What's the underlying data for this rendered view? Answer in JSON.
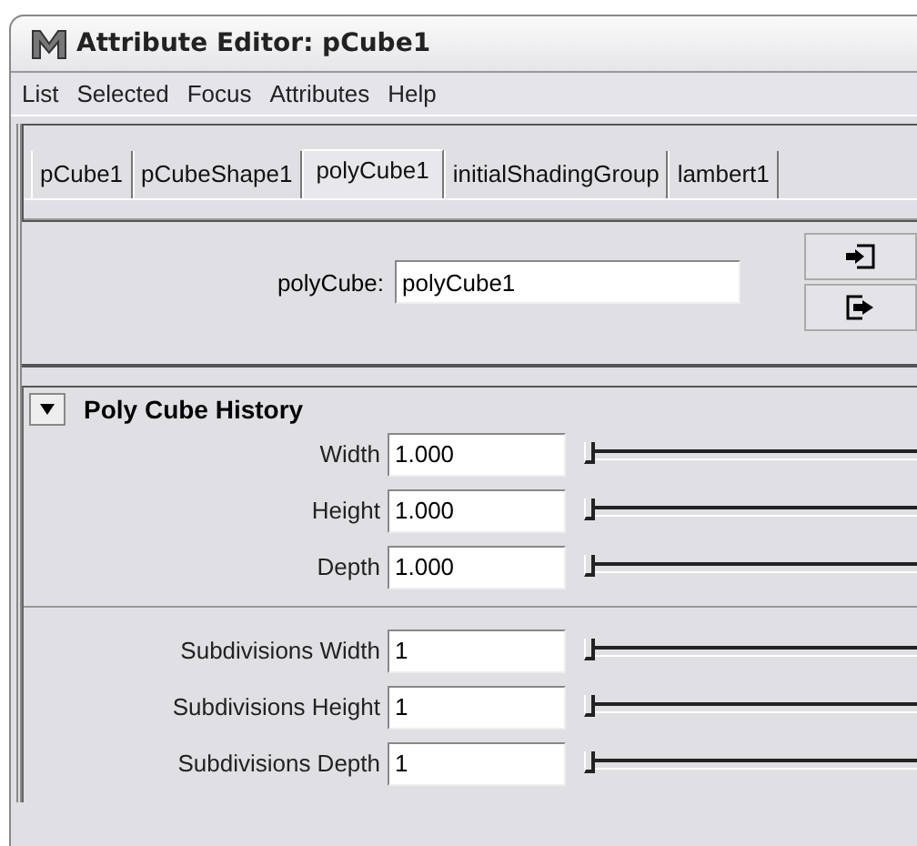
{
  "window": {
    "title": "Attribute Editor: pCube1"
  },
  "menu": [
    "List",
    "Selected",
    "Focus",
    "Attributes",
    "Help"
  ],
  "tabs": [
    {
      "label": "pCube1",
      "selected": false
    },
    {
      "label": "pCubeShape1",
      "selected": false
    },
    {
      "label": "polyCube1",
      "selected": true
    },
    {
      "label": "initialShadingGroup",
      "selected": false
    },
    {
      "label": "lambert1",
      "selected": false
    }
  ],
  "node": {
    "label": "polyCube:",
    "value": "polyCube1"
  },
  "section": {
    "title": "Poly Cube History",
    "expanded": true,
    "groups": [
      [
        {
          "label": "Width",
          "value": "1.000",
          "level": 0
        },
        {
          "label": "Height",
          "value": "1.000",
          "level": 0
        },
        {
          "label": "Depth",
          "value": "1.000",
          "level": 0
        }
      ],
      [
        {
          "label": "Subdivisions Width",
          "value": "1",
          "level": 0
        },
        {
          "label": "Subdivisions Height",
          "value": "1",
          "level": 0
        },
        {
          "label": "Subdivisions Depth",
          "value": "1",
          "level": 0
        }
      ]
    ]
  }
}
